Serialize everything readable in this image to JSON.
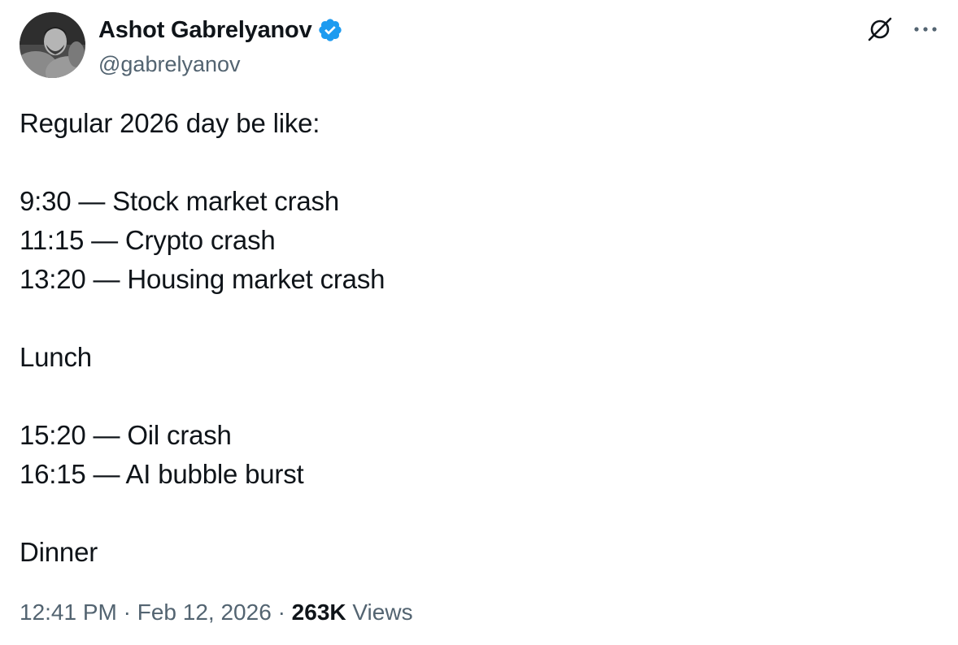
{
  "author": {
    "display_name": "Ashot Gabrelyanov",
    "handle": "@gabrelyanov",
    "verified_color": "#1d9bf0",
    "avatar_icon": "avatar-photo"
  },
  "actions": {
    "grok_icon": "grok-icon",
    "more_icon": "more-options-icon"
  },
  "post": {
    "lines": [
      "Regular 2026 day be like:",
      "",
      "9:30 — Stock market crash",
      "11:15 — Crypto crash",
      "13:20 — Housing market crash",
      "",
      "Lunch",
      "",
      "15:20 — Oil crash",
      "16:15 — AI bubble burst",
      "",
      "Dinner"
    ]
  },
  "meta": {
    "time": "12:41 PM",
    "separator": "·",
    "date": "Feb 12, 2026",
    "views_count": "263K",
    "views_label": "Views"
  },
  "colors": {
    "text_primary": "#0f1419",
    "text_secondary": "#536471",
    "verified_blue": "#1d9bf0"
  }
}
